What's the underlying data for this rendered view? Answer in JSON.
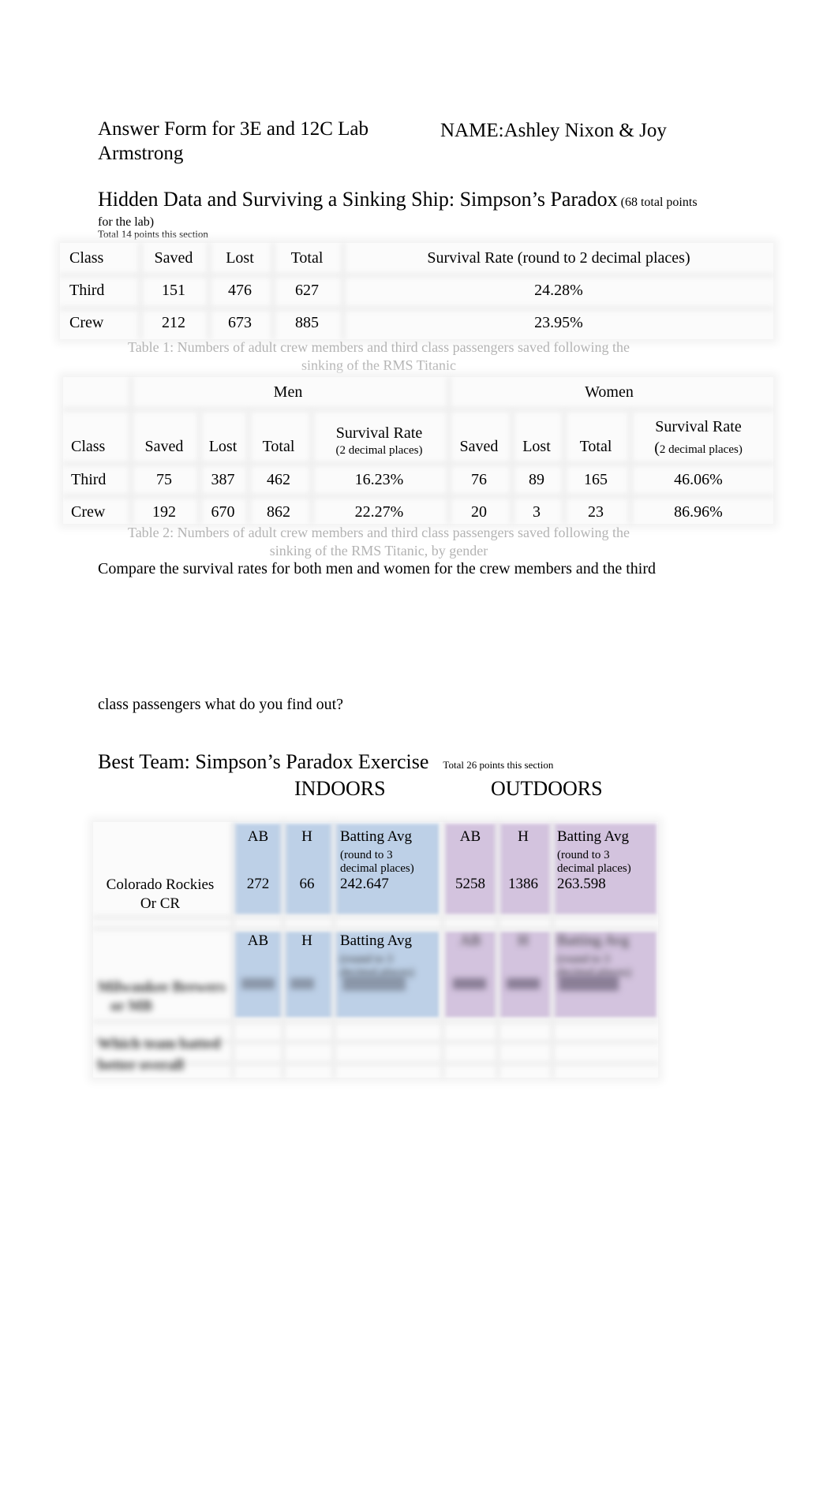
{
  "header": {
    "title": "Answer Form for 3E and 12C Lab",
    "name_label": "NAME:",
    "names_line1": "Ashley Nixon & Joy",
    "names_line2": "Armstrong"
  },
  "section1": {
    "heading": "Hidden Data and Surviving a Sinking Ship: Simpson’s Paradox",
    "points_note_a": "(68 total points",
    "points_note_b": "for the lab)",
    "section_points": "Total 14 points this section"
  },
  "table1": {
    "headers": [
      "Class",
      "Saved",
      "Lost",
      "Total",
      "Survival Rate (round to 2 decimal places)"
    ],
    "rows": [
      {
        "class": "Third",
        "saved": "151",
        "lost": "476",
        "total": "627",
        "rate": "24.28%"
      },
      {
        "class": "Crew",
        "saved": "212",
        "lost": "673",
        "total": "885",
        "rate": "23.95%"
      }
    ],
    "caption_line1": "Table 1: Numbers of adult crew members and third class passengers saved following the",
    "caption_line2": "sinking of the RMS Titanic"
  },
  "table2": {
    "group_men": "Men",
    "group_women": "Women",
    "headers": {
      "class": "Class",
      "saved": "Saved",
      "lost": "Lost",
      "total": "Total",
      "rate": "Survival Rate",
      "rate_note_men": "(2 decimal places)",
      "rate_note_women_paren": "(",
      "rate_note_women": "2 decimal places)"
    },
    "rows": [
      {
        "class": "Third",
        "men_saved": "75",
        "men_lost": "387",
        "men_total": "462",
        "men_rate": "16.23%",
        "women_saved": "76",
        "women_lost": "89",
        "women_total": "165",
        "women_rate": "46.06%"
      },
      {
        "class": "Crew",
        "men_saved": "192",
        "men_lost": "670",
        "men_total": "862",
        "men_rate": "22.27%",
        "women_saved": "20",
        "women_lost": "3",
        "women_total": "23",
        "women_rate": "86.96%"
      }
    ],
    "caption_line1": "Table 2: Numbers of adult crew members and third class passengers saved following the",
    "caption_line2": "sinking of the RMS Titanic, by gender"
  },
  "question": {
    "line1": "Compare the survival rates for both men and women for the crew members and the third",
    "line2": "class passengers what do you find out?"
  },
  "section2": {
    "heading": "Best Team: Simpson’s Paradox Exercise",
    "section_points": "Total 26 points this section",
    "indoors": "INDOORS",
    "outdoors": "OUTDOORS"
  },
  "baseball": {
    "col_ab": "AB",
    "col_h": "H",
    "col_avg": "Batting Avg",
    "avg_note_1": "(round to 3",
    "avg_note_2": "decimal places)",
    "team1_line1": "Colorado Rockies",
    "team1_line2": "Or CR",
    "team1": {
      "in_ab": "272",
      "in_h": "66",
      "in_avg": "242.647",
      "out_ab": "5258",
      "out_h": "1386",
      "out_avg": "263.598"
    },
    "team2_line1": "Milwaukee Brewers",
    "team2_line2": "or MB",
    "team3_line1": "Which team batted",
    "team3_line2": "better overall"
  },
  "colors": {
    "indoors_band": "#bdd0e7",
    "outdoors_band": "#d3c3de",
    "caption_gray": "#b3b3b3"
  }
}
